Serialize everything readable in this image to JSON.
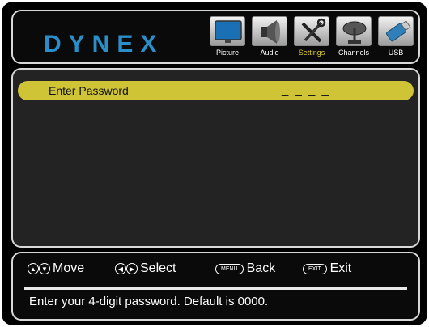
{
  "brand": {
    "logo_text": "DYNEX",
    "accent": "#2a8ec9"
  },
  "menu": {
    "active_color": "#e2d23b",
    "tabs": [
      {
        "label": "Picture",
        "icon": "tv-icon"
      },
      {
        "label": "Audio",
        "icon": "speaker-icon"
      },
      {
        "label": "Settings",
        "icon": "tools-icon",
        "active": true
      },
      {
        "label": "Channels",
        "icon": "satellite-dish-icon"
      },
      {
        "label": "USB",
        "icon": "usb-drive-icon"
      }
    ]
  },
  "settings": {
    "highlight_color": "#cfc436",
    "row": {
      "label": "Enter Password",
      "value": "_ _ _ _"
    }
  },
  "controls": {
    "move": {
      "glyphs": [
        "▲",
        "▼"
      ],
      "label": "Move"
    },
    "select": {
      "glyphs": [
        "◀",
        "▶"
      ],
      "label": "Select"
    },
    "back": {
      "key": "MENU",
      "label": "Back"
    },
    "exit": {
      "key": "EXIT",
      "label": "Exit"
    }
  },
  "help_text": "Enter your 4-digit password. Default is 0000."
}
